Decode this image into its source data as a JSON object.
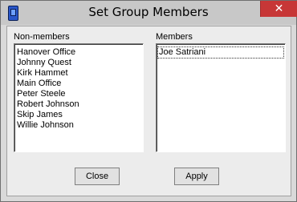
{
  "window": {
    "title": "Set Group Members",
    "close_glyph": "✕"
  },
  "nonmembers": {
    "label": "Non-members",
    "items": [
      "Hanover Office",
      "Johnny Quest",
      "Kirk Hammet",
      "Main Office",
      "Peter Steele",
      "Robert Johnson",
      "Skip James",
      "Willie Johnson"
    ]
  },
  "members": {
    "label": "Members",
    "items": [
      "Joe Satriani"
    ]
  },
  "buttons": {
    "close": "Close",
    "apply": "Apply"
  },
  "colors": {
    "close_button": "#c73737",
    "titlebar": "#c8c8c8",
    "dialog_bg": "#ececec"
  }
}
